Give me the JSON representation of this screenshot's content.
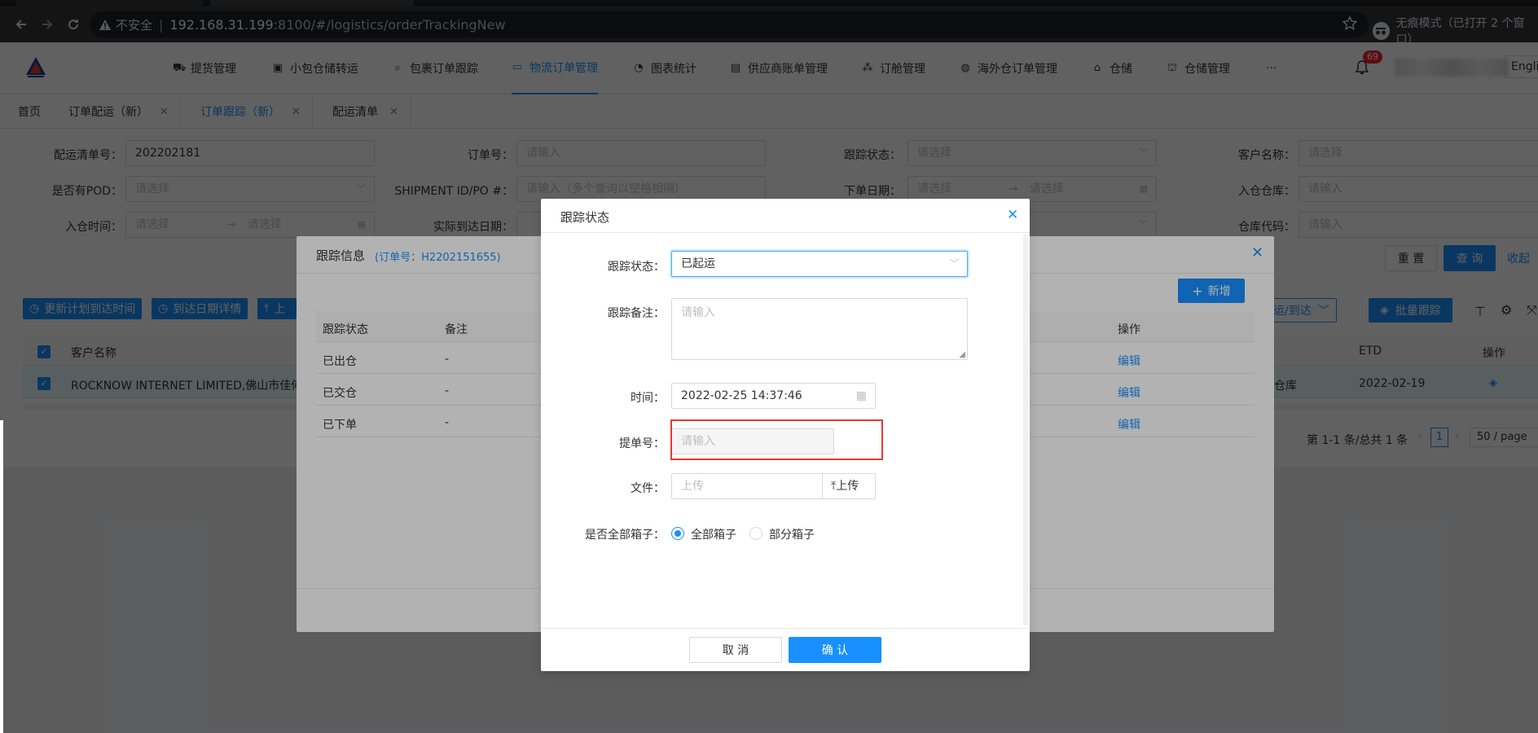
{
  "browser": {
    "insecure_label": "不安全",
    "url_host": "192.168.31.199",
    "url_path": ":8100/#/logistics/orderTrackingNew",
    "incognito_label": "无痕模式（已打开 2 个窗口）"
  },
  "header": {
    "nav": [
      {
        "label": "提货管理",
        "icon": "truck-icon"
      },
      {
        "label": "小包仓储转运",
        "icon": "box-icon"
      },
      {
        "label": "包裹订单跟踪",
        "icon": "search-icon"
      },
      {
        "label": "物流订单管理",
        "icon": "folder-icon"
      },
      {
        "label": "图表统计",
        "icon": "pie-chart-icon"
      },
      {
        "label": "供应商账单管理",
        "icon": "bill-icon"
      },
      {
        "label": "订舱管理",
        "icon": "cluster-icon"
      },
      {
        "label": "海外仓订单管理",
        "icon": "dashboard-icon"
      },
      {
        "label": "仓储",
        "icon": "home-icon"
      },
      {
        "label": "仓储管理",
        "icon": "bank-icon"
      },
      {
        "label": "···",
        "icon": "more-icon"
      }
    ],
    "notification_count": "69",
    "lang": "English"
  },
  "tags": [
    {
      "label": "首页"
    },
    {
      "label": "订单配运（新）"
    },
    {
      "label": "订单跟踪（新）"
    },
    {
      "label": "配运清单"
    }
  ],
  "filters": {
    "delivery_no_label": "配运清单号：",
    "delivery_no_value": "202202181",
    "order_no_label": "订单号：",
    "order_no_placeholder": "请输入",
    "track_status_label": "跟踪状态：",
    "track_status_placeholder": "请选择",
    "customer_label": "客户名称：",
    "customer_placeholder": "请选择",
    "pod_label": "是否有POD：",
    "pod_placeholder": "请选择",
    "shipment_label": "SHIPMENT ID/PO #：",
    "shipment_placeholder": "请输入（多个查询以空格相隔）",
    "order_date_label": "下单日期：",
    "date_placeholder": "请选择",
    "arrow": "→",
    "warehouse_label": "入仓仓库：",
    "warehouse_placeholder": "请输入",
    "in_time_label": "入仓时间：",
    "actual_arrival_label": "实际到达日期：",
    "warehouse_code_label": "仓库代码：",
    "warehouse_code_placeholder": "请输入",
    "reset": "重 置",
    "query": "查 询",
    "collapse": "收起"
  },
  "table": {
    "btn_update_plan": "更新计划到达时间",
    "btn_arrival_detail": "到达日期详情",
    "btn_upload": "上",
    "btn_batch_ship": "起运/到达",
    "btn_batch_track": "批量跟踪",
    "col_customer": "客户名称",
    "col_etd": "ETD",
    "col_op": "操作",
    "row_customer": "ROCKNOW INTERNET LIMITED,佛山市佳何...",
    "row_warehouse": "仓库",
    "row_etd": "2022-02-19",
    "pagination": "第 1-1 条/总共 1 条",
    "page": "1",
    "page_size": "50 / page"
  },
  "track_modal": {
    "title": "跟踪信息",
    "order_label": "(订单号：H2202151655)",
    "add_btn": "新增",
    "col_status": "跟踪状态",
    "col_remark": "备注",
    "col_op": "操作",
    "rows": [
      {
        "status": "已出仓",
        "remark": "-",
        "op": "编辑"
      },
      {
        "status": "已交仓",
        "remark": "-",
        "op": "编辑"
      },
      {
        "status": "已下单",
        "remark": "-",
        "op": "编辑"
      }
    ]
  },
  "modal": {
    "title": "跟踪状态",
    "status_label": "跟踪状态：",
    "status_value": "已起运",
    "remark_label": "跟踪备注：",
    "remark_placeholder": "请输入",
    "time_label": "时间：",
    "time_value": "2022-02-25 14:37:46",
    "bl_label": "提单号：",
    "bl_placeholder": "请输入",
    "file_label": "文件：",
    "file_placeholder": "上传",
    "upload_btn": "上传",
    "all_boxes_label": "是否全部箱子：",
    "opt_all": "全部箱子",
    "opt_partial": "部分箱子",
    "cancel": "取 消",
    "confirm": "确 认"
  },
  "colors": {
    "primary": "#1890ff",
    "highlight": "#e53935"
  }
}
